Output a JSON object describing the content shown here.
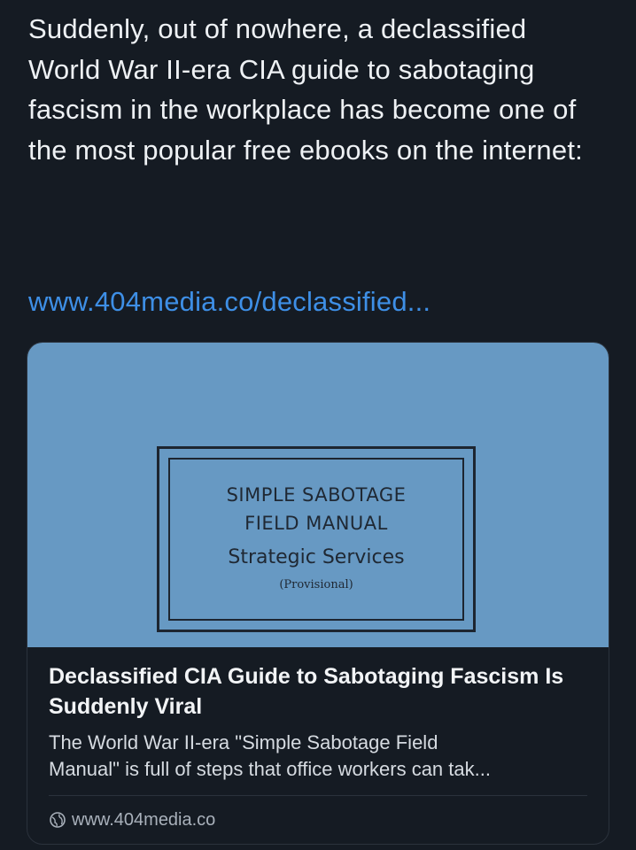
{
  "post": {
    "text": "Suddenly, out of nowhere, a declassified World War II-era CIA guide to sabotaging fascism in the workplace has become one of the most popular free ebooks on the internet:",
    "link_text": "www.404media.co/declassified..."
  },
  "card": {
    "image": {
      "manual_title": "SIMPLE SABOTAGE\nFIELD MANUAL",
      "services": "Strategic Services",
      "provisional": "(Provisional)",
      "background_color": "#6799c3"
    },
    "title": "Declassified CIA Guide to Sabotaging Fascism Is Suddenly Viral",
    "description": "The World War II-era \"Simple Sabotage Field\nManual\" is full of steps that office workers can tak...",
    "domain": "www.404media.co",
    "domain_icon": "globe-icon"
  },
  "colors": {
    "background": "#151b23",
    "link": "#3e8fe6",
    "text": "#eef1f4"
  }
}
